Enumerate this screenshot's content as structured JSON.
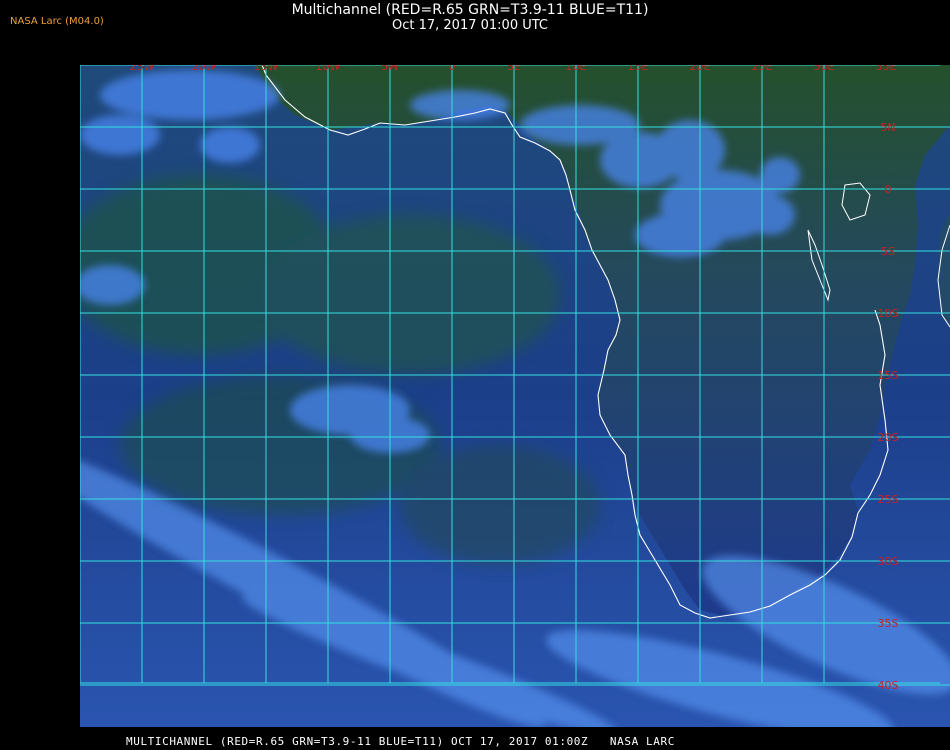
{
  "header": {
    "credit": "NASA Larc (M04.0)",
    "title": "Multichannel (RED=R.65 GRN=T3.9-11 BLUE=T11)",
    "datetime": "Oct 17, 2017 01:00 UTC"
  },
  "map": {
    "lon_labels": [
      "25W",
      "20W",
      "15W",
      "10W",
      "5W",
      "0",
      "5E",
      "10E",
      "15E",
      "20E",
      "25E",
      "30E",
      "35E"
    ],
    "lat_labels": [
      "5N",
      "0",
      "5S",
      "10S",
      "15S",
      "20S",
      "25S",
      "30S",
      "35S",
      "40S"
    ],
    "colors": {
      "ocean": "#1b3f86",
      "land": "#1f5a2a",
      "cloud": "#4a86f0",
      "grid": "#33e0e0",
      "label": "#cc2020",
      "coast": "#ffffff"
    }
  },
  "footer": {
    "text": "MULTICHANNEL (RED=R.65 GRN=T3.9-11 BLUE=T11) OCT 17, 2017 01:00Z   NASA LARC"
  }
}
